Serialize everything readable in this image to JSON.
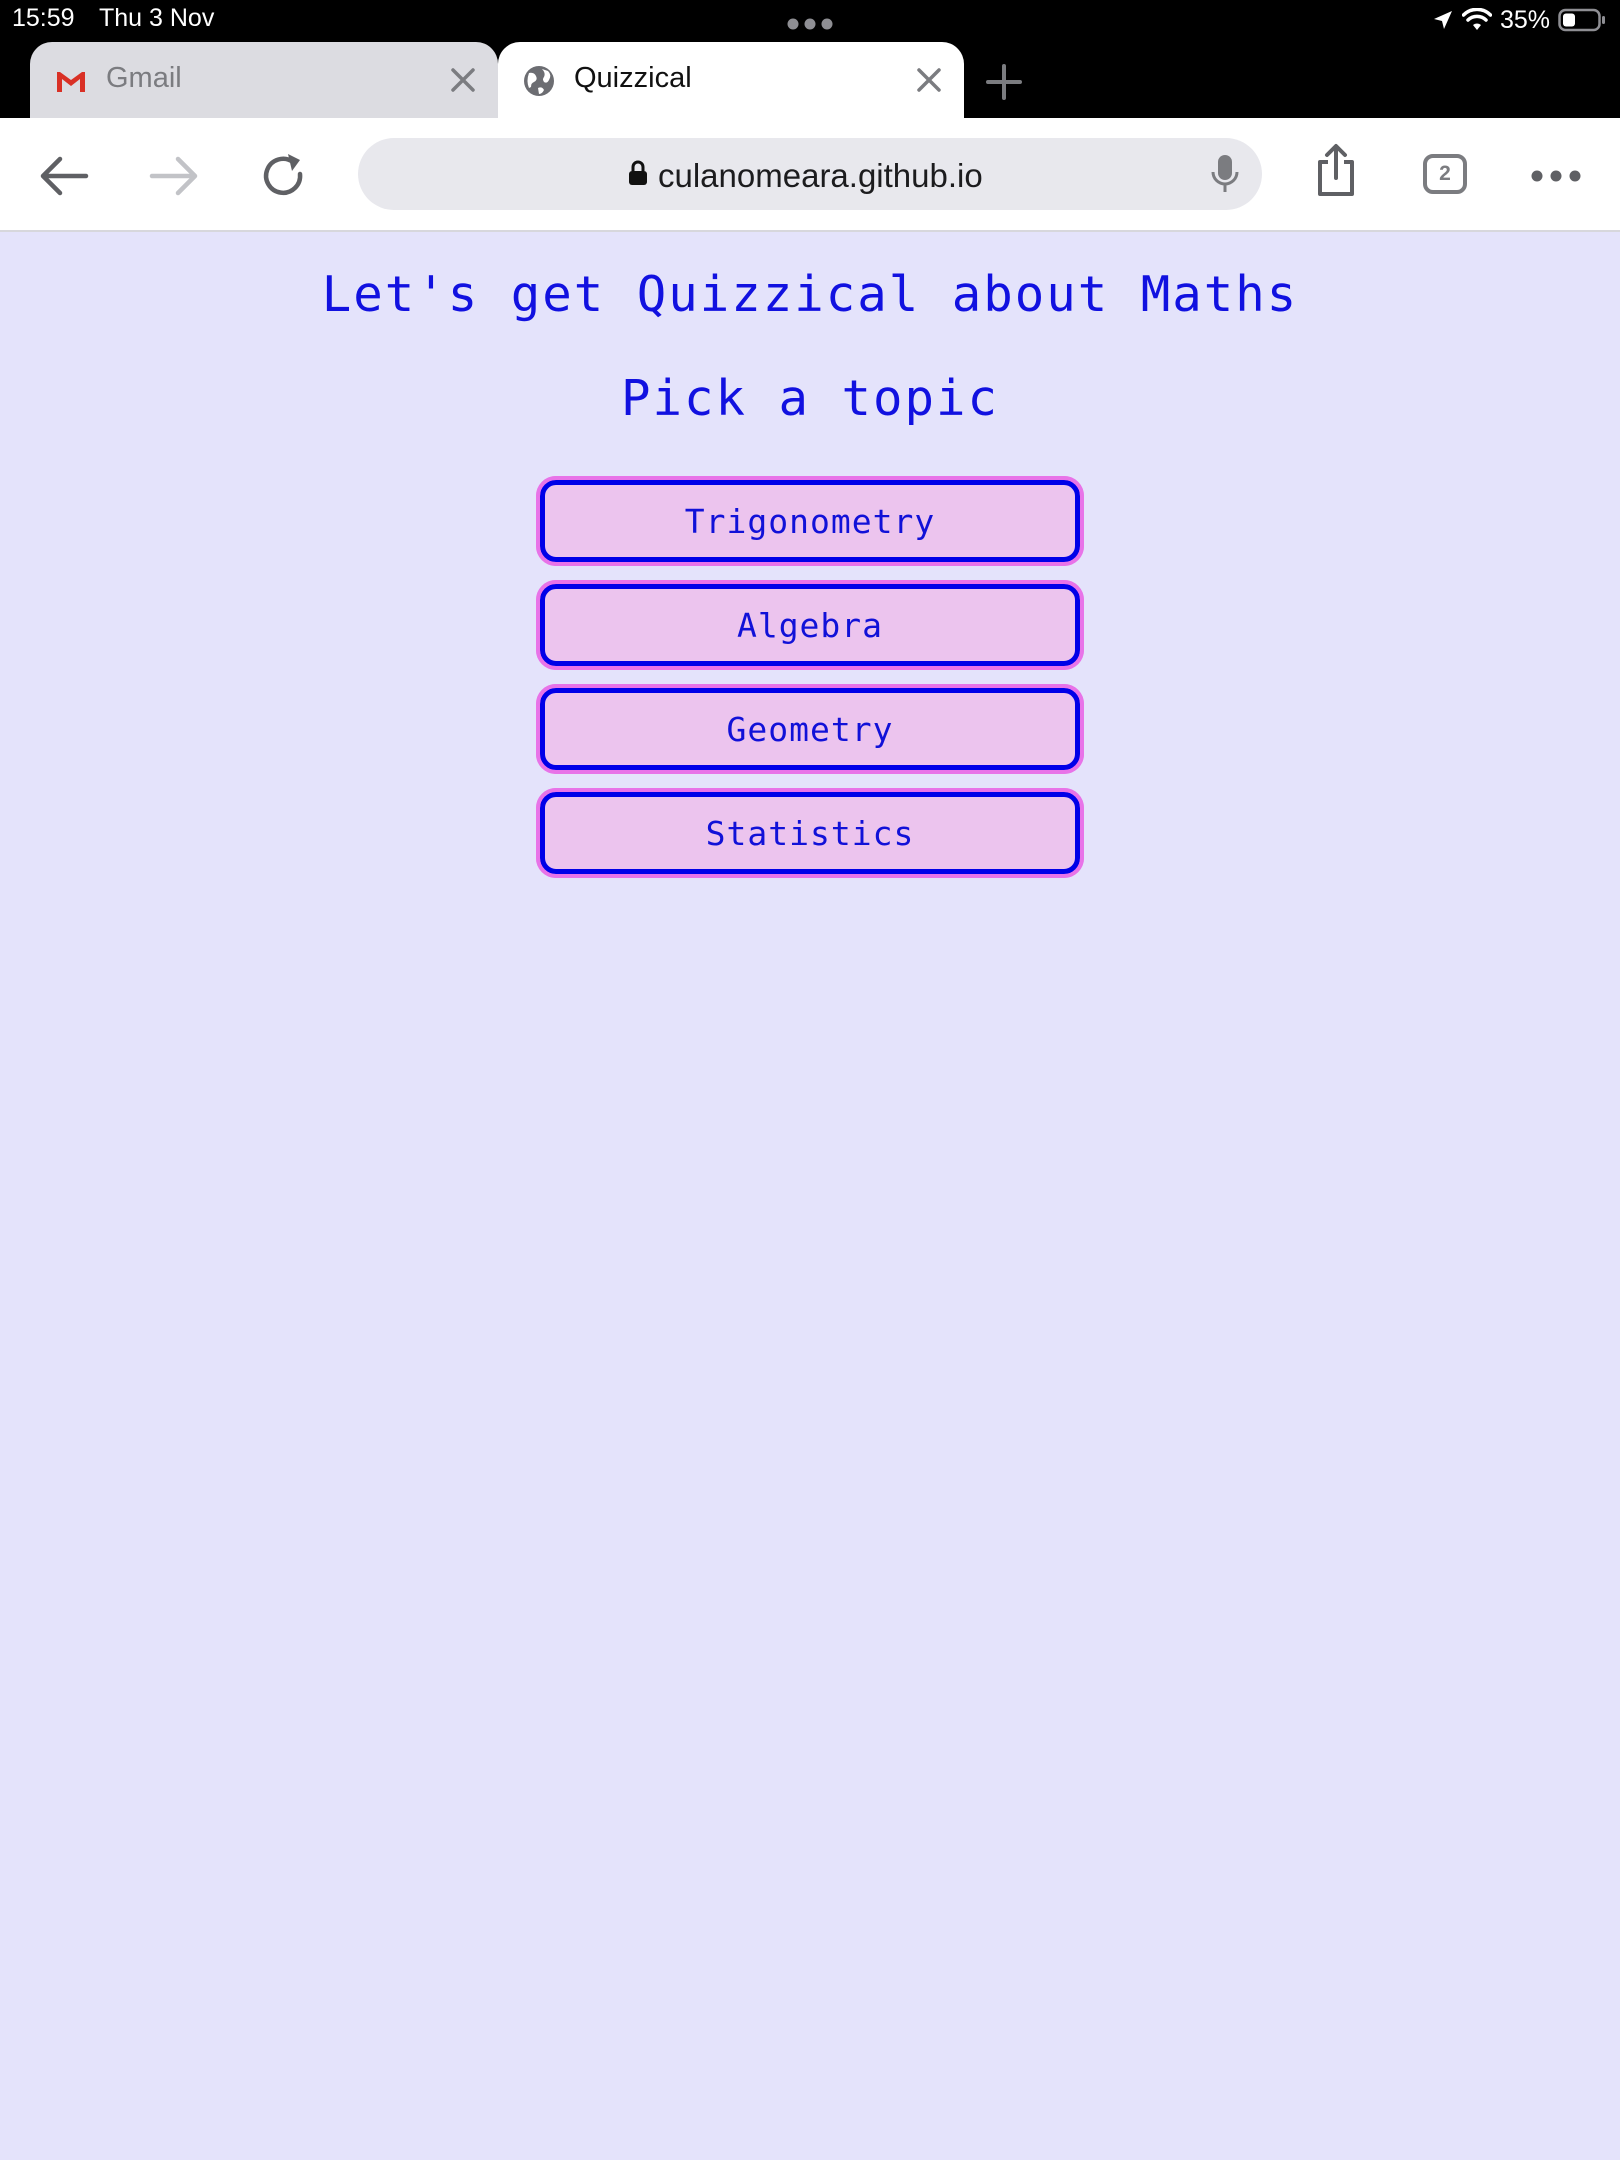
{
  "status_bar": {
    "time": "15:59",
    "date": "Thu 3 Nov",
    "battery": "35%"
  },
  "tabs": [
    {
      "title": "Gmail",
      "icon": "gmail-icon",
      "active": false
    },
    {
      "title": "Quizzical",
      "icon": "globe-icon",
      "active": true
    }
  ],
  "toolbar": {
    "url": "culanomeara.github.io",
    "tab_count": "2"
  },
  "page": {
    "title": "Let's get Quizzical about Maths",
    "subtitle": "Pick a topic",
    "topics": [
      "Trigonometry",
      "Algebra",
      "Geometry",
      "Statistics"
    ]
  },
  "colors": {
    "page_background": "#e4e3fb",
    "text": "#1111e0",
    "button_fill": "#ecc4ee",
    "button_border": "#0000e8",
    "button_outline": "#e873e8"
  }
}
